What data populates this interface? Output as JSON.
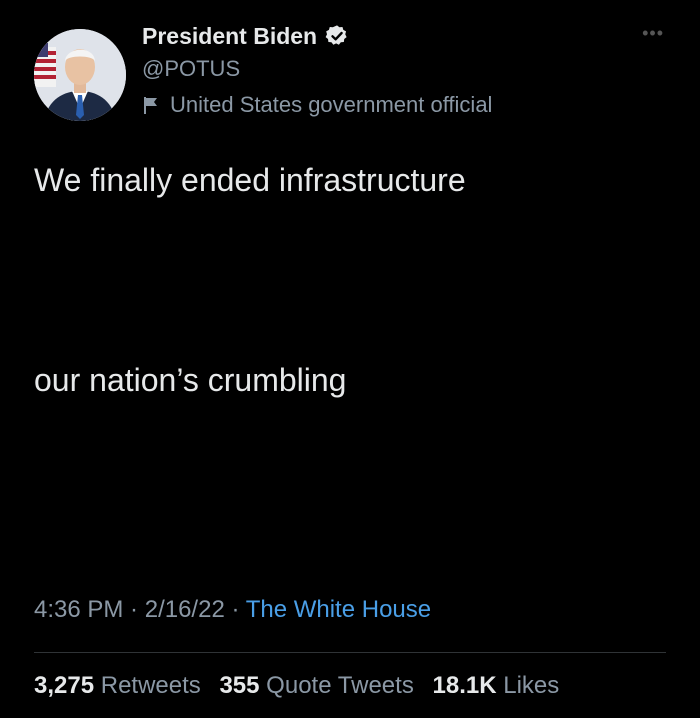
{
  "author": {
    "display_name": "President Biden",
    "handle": "@POTUS",
    "label": "United States government official",
    "verified": true
  },
  "tweet": {
    "line1": "We finally ended infrastructure",
    "line2": "our nation’s crumbling"
  },
  "meta": {
    "time": "4:36 PM",
    "sep1": " · ",
    "date": "2/16/22",
    "sep2": " · ",
    "source": "The White House"
  },
  "stats": {
    "retweets_count": "3,275",
    "retweets_label": "Retweets",
    "quote_count": "355",
    "quote_label": "Quote Tweets",
    "likes_count": "18.1K",
    "likes_label": "Likes"
  },
  "icons": {
    "more": "more-horizontal-icon",
    "verified": "verified-badge-icon",
    "label": "government-flag-icon"
  },
  "colors": {
    "background": "#000000",
    "text_primary": "#e7e9ea",
    "text_secondary": "#8b98a5",
    "link": "#4a9fe7"
  }
}
